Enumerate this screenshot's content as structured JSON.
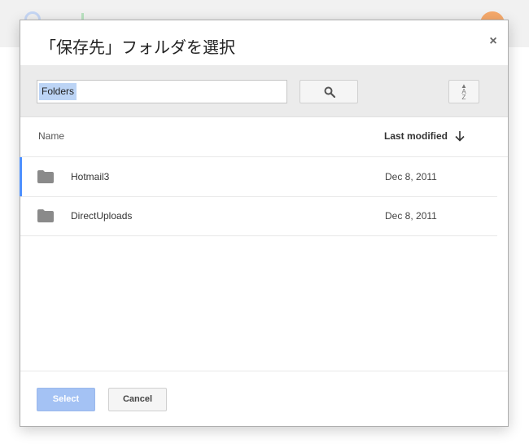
{
  "dialog": {
    "title": "「保存先」フォルダを選択",
    "close_label": "×"
  },
  "search": {
    "value": "Folders"
  },
  "sort": {
    "top_letter": "A",
    "bottom_letter": "Z"
  },
  "columns": {
    "name": "Name",
    "last_modified": "Last modified"
  },
  "rows": [
    {
      "name": "Hotmail3",
      "date": "Dec 8, 2011"
    },
    {
      "name": "DirectUploads",
      "date": "Dec 8, 2011"
    }
  ],
  "buttons": {
    "select": "Select",
    "cancel": "Cancel"
  },
  "colors": {
    "accent": "#4d90fe",
    "select_button": "#a4c2f4",
    "toolbar_bg": "#ebebeb"
  }
}
